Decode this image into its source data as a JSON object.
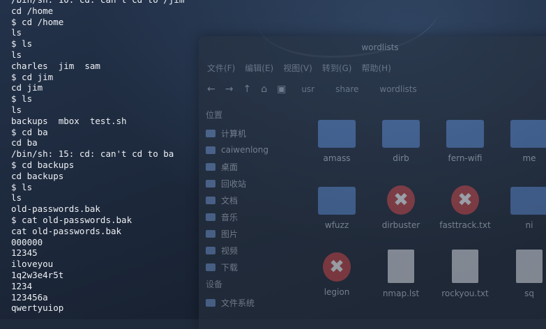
{
  "terminal": {
    "lines": [
      "/bin/sh: 10: cd: can't cd to /jim",
      "cd /home",
      "$ cd /home",
      "ls",
      "$ ls",
      "ls",
      "charles  jim  sam",
      "$ cd jim",
      "cd jim",
      "$ ls",
      "ls",
      "backups  mbox  test.sh",
      "$ cd ba",
      "cd ba",
      "/bin/sh: 15: cd: can't cd to ba",
      "$ cd backups",
      "cd backups",
      "$ ls",
      "ls",
      "old-passwords.bak",
      "$ cat old-passwords.bak",
      "cat old-passwords.bak",
      "000000",
      "12345",
      "iloveyou",
      "1q2w3e4r5t",
      "1234",
      "123456a",
      "qwertyuiop"
    ]
  },
  "file_manager": {
    "title": "wordlists",
    "menu": [
      "文件(F)",
      "编辑(E)",
      "视图(V)",
      "转到(G)",
      "帮助(H)"
    ],
    "breadcrumb": [
      "usr",
      "share",
      "wordlists"
    ],
    "sidebar_heading": "位置",
    "sidebar_items": [
      {
        "label": "计算机",
        "icon": "computer-icon"
      },
      {
        "label": "caiwenlong",
        "icon": "home-folder-icon"
      },
      {
        "label": "桌面",
        "icon": "desktop-icon"
      },
      {
        "label": "回收站",
        "icon": "trash-icon"
      },
      {
        "label": "文档",
        "icon": "documents-icon"
      },
      {
        "label": "音乐",
        "icon": "music-icon"
      },
      {
        "label": "图片",
        "icon": "pictures-icon"
      },
      {
        "label": "视频",
        "icon": "videos-icon"
      },
      {
        "label": "下载",
        "icon": "downloads-icon"
      }
    ],
    "devices_heading": "设备",
    "device_item": "文件系统",
    "files": [
      {
        "name": "amass",
        "type": "folder"
      },
      {
        "name": "dirb",
        "type": "folder"
      },
      {
        "name": "fern-wifi",
        "type": "folder"
      },
      {
        "name": "me",
        "type": "folder"
      },
      {
        "name": "wfuzz",
        "type": "folder"
      },
      {
        "name": "dirbuster",
        "type": "broken-link"
      },
      {
        "name": "fasttrack.txt",
        "type": "broken-link"
      },
      {
        "name": "ni",
        "type": "folder"
      },
      {
        "name": "legion",
        "type": "broken-link"
      },
      {
        "name": "nmap.lst",
        "type": "file"
      },
      {
        "name": "rockyou.txt",
        "type": "file"
      },
      {
        "name": "sq",
        "type": "file"
      }
    ]
  },
  "colors": {
    "terminal_text": "#eef1f5",
    "folder": "#5b86c7",
    "broken_link": "#c94b4b"
  }
}
